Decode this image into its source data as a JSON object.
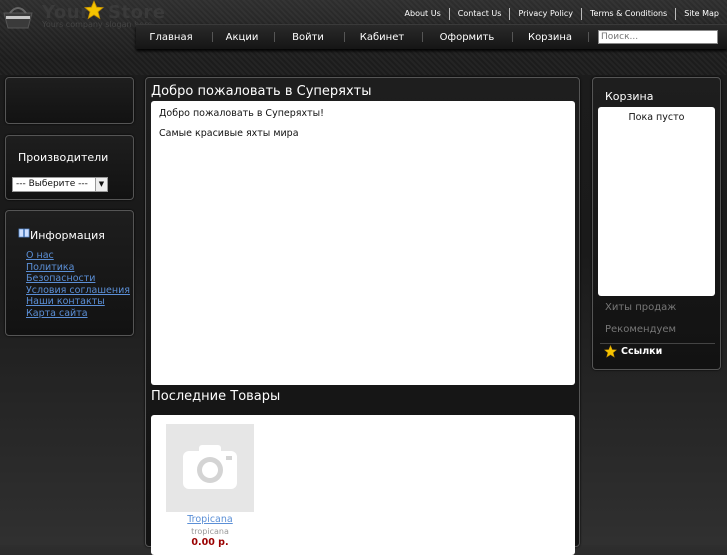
{
  "logo": {
    "word1": "Your",
    "word2": "Store",
    "slogan": "Yours company slogan here"
  },
  "toplinks": [
    "About Us",
    "Contact Us",
    "Privacy Policy",
    "Terms & Conditions",
    "Site Map"
  ],
  "menu": [
    "Главная",
    "Акции",
    "Войти",
    "Кабинет",
    "Оформить",
    "Корзина"
  ],
  "search": {
    "placeholder": "Поиск..."
  },
  "manufacturers": {
    "title": "Производители",
    "select_value": "--- Выберите ---"
  },
  "information": {
    "title": "Информация",
    "links": [
      "О нас",
      "Политика",
      "Безопасности",
      "Условия соглашения",
      "Наши контакты",
      "Карта сайта"
    ]
  },
  "welcome": {
    "title": "Добро пожаловать в Суперяхты",
    "line1": "Добро пожаловать в Суперяхты!",
    "line2": "Самые красивые яхты мира"
  },
  "latest": {
    "title": "Последние Товары",
    "product": {
      "name": "Tropicana",
      "model": "tropicana",
      "price": "0.00 р."
    }
  },
  "cart": {
    "title": "Корзина",
    "empty": "Пока пусто",
    "tabs": [
      "Хиты продаж",
      "Рекомендуем"
    ],
    "links_title": "Ссылки"
  },
  "colors": {
    "link": "#5b8fd6",
    "price": "#990000",
    "star": "#f5c400"
  }
}
